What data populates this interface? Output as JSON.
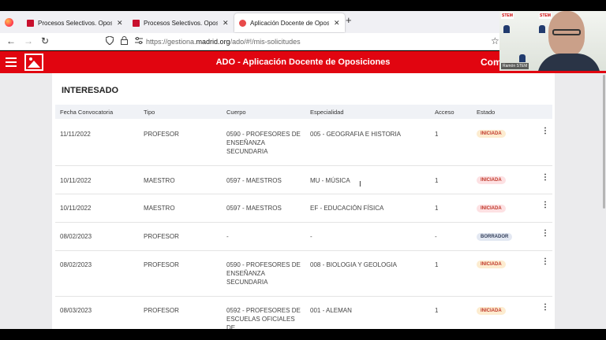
{
  "browser": {
    "tabs": [
      {
        "title": "Procesos Selectivos. Oposiciones"
      },
      {
        "title": "Procesos Selectivos. Oposiciones"
      },
      {
        "title": "Aplicación Docente de Oposicio..."
      }
    ],
    "close_glyph": "✕",
    "new_tab_glyph": "+",
    "back_glyph": "←",
    "forward_glyph": "→",
    "reload_glyph": "↻",
    "url_prefix": "https://gestiona.",
    "url_domain": "madrid.org",
    "url_path": "/ado/#!/mis-solicitudes",
    "bookmark_glyph": "☆"
  },
  "app": {
    "title": "ADO - Aplicación Docente de Oposiciones",
    "title_right": "Com"
  },
  "section": {
    "title": "INTERESADO"
  },
  "table": {
    "headers": [
      "Fecha Convocatoria",
      "Tipo",
      "Cuerpo",
      "Especialidad",
      "Acceso",
      "Estado"
    ],
    "rows": [
      {
        "fecha": "11/11/2022",
        "tipo": "PROFESOR",
        "cuerpo": "0590 - PROFESORES DE ENSEÑANZA SECUNDARIA",
        "especialidad": "005 - GEOGRAFIA E HISTORIA",
        "acceso": "1",
        "estado": "INICIADA"
      },
      {
        "fecha": "10/11/2022",
        "tipo": "MAESTRO",
        "cuerpo": "0597 - MAESTROS",
        "especialidad": "MU - MÚSICA",
        "acceso": "1",
        "estado": "INICIADA"
      },
      {
        "fecha": "10/11/2022",
        "tipo": "MAESTRO",
        "cuerpo": "0597 - MAESTROS",
        "especialidad": "EF - EDUCACIÓN FÍSICA",
        "acceso": "1",
        "estado": "INICIADA"
      },
      {
        "fecha": "08/02/2023",
        "tipo": "PROFESOR",
        "cuerpo": "-",
        "especialidad": "-",
        "acceso": "-",
        "estado": "BORRADOR"
      },
      {
        "fecha": "08/02/2023",
        "tipo": "PROFESOR",
        "cuerpo": "0590 - PROFESORES DE ENSEÑANZA SECUNDARIA",
        "especialidad": "008 - BIOLOGIA Y GEOLOGIA",
        "acceso": "1",
        "estado": "INICIADA"
      },
      {
        "fecha": "08/03/2023",
        "tipo": "PROFESOR",
        "cuerpo": "0592 - PROFESORES DE ESCUELAS OFICIALES DE",
        "especialidad": "001 - ALEMAN",
        "acceso": "1",
        "estado": "INICIADA"
      }
    ],
    "kebab_glyph": "⋮"
  },
  "colors": {
    "brand_red": "#e10510",
    "badge_iniciada_bg": "#fdecd0",
    "badge_iniciada_fg": "#c0392b",
    "badge_pink_bg": "#fde1e3",
    "badge_pink_fg": "#c0392b",
    "badge_borrador_bg": "#e3e8f2",
    "badge_borrador_fg": "#333f5a"
  },
  "webcam": {
    "logo_text": "STEM",
    "name_text": "Ramón STEM"
  }
}
